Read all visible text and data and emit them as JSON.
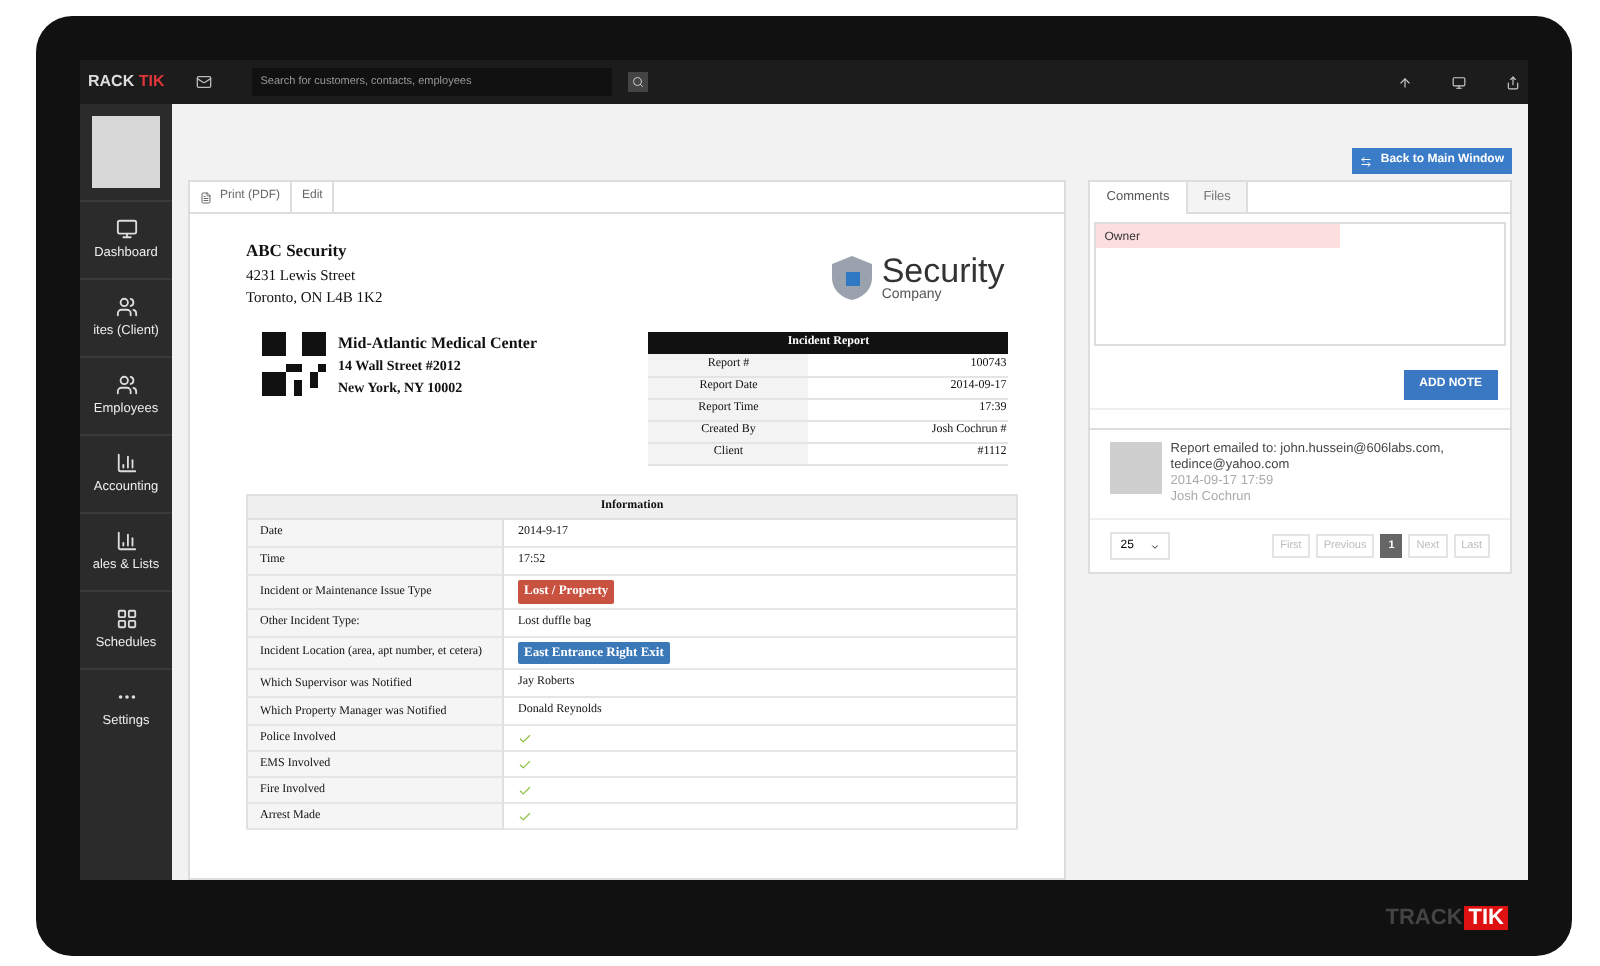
{
  "topbar": {
    "logo_dark": "RACK",
    "logo_accent": "TIK",
    "search": {
      "placeholder": "Search for customers, contacts, employees"
    }
  },
  "sidebar": {
    "items": [
      {
        "label": "Dashboard"
      },
      {
        "label": "ites (Client)"
      },
      {
        "label": "Employees"
      },
      {
        "label": "Accounting"
      },
      {
        "label": "ales & Lists"
      },
      {
        "label": "Schedules"
      },
      {
        "label": "Settings"
      }
    ]
  },
  "back_button": "Back to Main Window",
  "document": {
    "toolbar": [
      "Print (PDF)",
      "Edit"
    ],
    "company": {
      "name": "ABC Security",
      "lines": [
        "4231 Lewis Street",
        "Toronto, ON  L4B 1K2"
      ]
    },
    "logo": {
      "word": "Security",
      "sub": "Company"
    },
    "client": {
      "name": "Mid-Atlantic Medical Center",
      "lines": [
        "14 Wall Street #2012",
        "New York, NY 10002"
      ]
    },
    "report": {
      "title": "Incident Report",
      "rows": [
        [
          "Report #",
          "100743"
        ],
        [
          "Report Date",
          "2014-09-17"
        ],
        [
          "Report Time",
          "17:39"
        ],
        [
          "Created By",
          "Josh Cochrun #"
        ],
        [
          "Client",
          "#1112"
        ]
      ]
    },
    "information": {
      "title": "Information",
      "rows": [
        {
          "label": "Date",
          "kind": "text",
          "value": "2014-9-17"
        },
        {
          "label": "Time",
          "kind": "text",
          "value": "17:52"
        },
        {
          "label": "Incident or Maintenance Issue Type",
          "kind": "badge",
          "value": "Lost / Property",
          "color": "#c9513f"
        },
        {
          "label": "Other Incident Type:",
          "kind": "text",
          "value": "Lost duffle bag"
        },
        {
          "label": "Incident Location (area, apt number, et cetera)",
          "kind": "badge",
          "value": "East Entrance Right Exit",
          "color": "#3a78b8"
        },
        {
          "label": "Which Supervisor was Notified",
          "kind": "text",
          "value": "Jay Roberts"
        },
        {
          "label": "Which Property Manager was Notified",
          "kind": "text",
          "value": "Donald Reynolds"
        },
        {
          "label": "Police Involved",
          "kind": "check"
        },
        {
          "label": "EMS Involved",
          "kind": "check"
        },
        {
          "label": "Fire Involved",
          "kind": "check"
        },
        {
          "label": "Arrest Made",
          "kind": "check"
        }
      ]
    }
  },
  "comments": {
    "tabs": [
      {
        "label": "Comments",
        "selected": true
      },
      {
        "label": "Files",
        "selected": false
      }
    ],
    "note": {
      "value": "Owner"
    },
    "add_button": "ADD NOTE",
    "entries": [
      {
        "text": "Report emailed to: john.hussein@606labs.com, tedince@yahoo.com",
        "date": "2014-09-17 17:59",
        "author": "Josh Cochrun"
      }
    ],
    "page_size": "25",
    "pager": [
      {
        "label": "First",
        "selected": false
      },
      {
        "label": "Previous",
        "selected": false
      },
      {
        "label": "1",
        "selected": true
      },
      {
        "label": "Next",
        "selected": false
      },
      {
        "label": "Last",
        "selected": false
      }
    ]
  },
  "bezel_logo": {
    "dark": "TRACK",
    "accent": "TIK"
  }
}
